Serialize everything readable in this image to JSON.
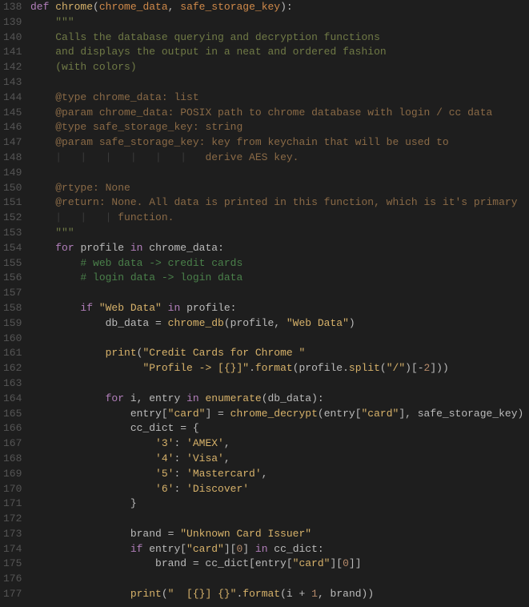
{
  "lines": [
    {
      "n": 138,
      "t": [
        [
          "kw",
          "def "
        ],
        [
          "fn",
          "chrome"
        ],
        [
          "plain",
          "("
        ],
        [
          "param",
          "chrome_data"
        ],
        [
          "plain",
          ", "
        ],
        [
          "param",
          "safe_storage_key"
        ],
        [
          "plain",
          "):"
        ]
      ]
    },
    {
      "n": 139,
      "t": [
        [
          "plain",
          "    "
        ],
        [
          "doc",
          "\"\"\""
        ]
      ]
    },
    {
      "n": 140,
      "t": [
        [
          "plain",
          "    "
        ],
        [
          "doc",
          "Calls the database querying and decryption functions"
        ]
      ]
    },
    {
      "n": 141,
      "t": [
        [
          "plain",
          "    "
        ],
        [
          "doc",
          "and displays the output in a neat and ordered fashion"
        ]
      ]
    },
    {
      "n": 142,
      "t": [
        [
          "plain",
          "    "
        ],
        [
          "doc",
          "(with colors)"
        ]
      ]
    },
    {
      "n": 143,
      "t": [
        [
          "plain",
          ""
        ]
      ]
    },
    {
      "n": 144,
      "t": [
        [
          "plain",
          "    "
        ],
        [
          "doctag",
          "@type chrome_data: list"
        ]
      ]
    },
    {
      "n": 145,
      "t": [
        [
          "plain",
          "    "
        ],
        [
          "doctag",
          "@param chrome_data: POSIX path to chrome database with login / cc data"
        ]
      ]
    },
    {
      "n": 146,
      "t": [
        [
          "plain",
          "    "
        ],
        [
          "doctag",
          "@type safe_storage_key: string"
        ]
      ]
    },
    {
      "n": 147,
      "t": [
        [
          "plain",
          "    "
        ],
        [
          "doctag",
          "@param safe_storage_key: key from keychain that will be used to"
        ]
      ]
    },
    {
      "n": 148,
      "t": [
        [
          "plain",
          "    "
        ],
        [
          "indentmk",
          "|   |   |   |   |   |   "
        ],
        [
          "doctag",
          "derive AES key."
        ]
      ]
    },
    {
      "n": 149,
      "t": [
        [
          "plain",
          ""
        ]
      ]
    },
    {
      "n": 150,
      "t": [
        [
          "plain",
          "    "
        ],
        [
          "doctag",
          "@rtype: None"
        ]
      ]
    },
    {
      "n": 151,
      "t": [
        [
          "plain",
          "    "
        ],
        [
          "doctag",
          "@return: None. All data is printed in this function, which is it's primary"
        ]
      ]
    },
    {
      "n": 152,
      "t": [
        [
          "plain",
          "    "
        ],
        [
          "indentmk",
          "|   |   | "
        ],
        [
          "doctag",
          "function."
        ]
      ]
    },
    {
      "n": 153,
      "t": [
        [
          "plain",
          "    "
        ],
        [
          "doc",
          "\"\"\""
        ]
      ]
    },
    {
      "n": 154,
      "t": [
        [
          "plain",
          "    "
        ],
        [
          "kw",
          "for "
        ],
        [
          "plain",
          "profile "
        ],
        [
          "kw",
          "in "
        ],
        [
          "plain",
          "chrome_data:"
        ]
      ]
    },
    {
      "n": 155,
      "t": [
        [
          "plain",
          "        "
        ],
        [
          "comment",
          "# web data -> credit cards"
        ]
      ]
    },
    {
      "n": 156,
      "t": [
        [
          "plain",
          "        "
        ],
        [
          "comment",
          "# login data -> login data"
        ]
      ]
    },
    {
      "n": 157,
      "t": [
        [
          "plain",
          ""
        ]
      ]
    },
    {
      "n": 158,
      "t": [
        [
          "plain",
          "        "
        ],
        [
          "kw",
          "if "
        ],
        [
          "str",
          "\"Web Data\""
        ],
        [
          "plain",
          " "
        ],
        [
          "kw",
          "in "
        ],
        [
          "plain",
          "profile:"
        ]
      ]
    },
    {
      "n": 159,
      "t": [
        [
          "plain",
          "            db_data = "
        ],
        [
          "fn",
          "chrome_db"
        ],
        [
          "plain",
          "(profile, "
        ],
        [
          "str",
          "\"Web Data\""
        ],
        [
          "plain",
          ")"
        ]
      ]
    },
    {
      "n": 160,
      "t": [
        [
          "plain",
          ""
        ]
      ]
    },
    {
      "n": 161,
      "t": [
        [
          "plain",
          "            "
        ],
        [
          "fn",
          "print"
        ],
        [
          "plain",
          "("
        ],
        [
          "str",
          "\"Credit Cards for Chrome \""
        ]
      ]
    },
    {
      "n": 162,
      "t": [
        [
          "plain",
          "                  "
        ],
        [
          "str",
          "\"Profile -> [{}]\""
        ],
        [
          "plain",
          "."
        ],
        [
          "fn",
          "format"
        ],
        [
          "plain",
          "(profile."
        ],
        [
          "fn",
          "split"
        ],
        [
          "plain",
          "("
        ],
        [
          "str",
          "\"/\""
        ],
        [
          "plain",
          ")[-"
        ],
        [
          "num",
          "2"
        ],
        [
          "plain",
          "]))"
        ]
      ]
    },
    {
      "n": 163,
      "t": [
        [
          "plain",
          ""
        ]
      ]
    },
    {
      "n": 164,
      "t": [
        [
          "plain",
          "            "
        ],
        [
          "kw",
          "for "
        ],
        [
          "plain",
          "i, entry "
        ],
        [
          "kw",
          "in "
        ],
        [
          "fn",
          "enumerate"
        ],
        [
          "plain",
          "(db_data):"
        ]
      ]
    },
    {
      "n": 165,
      "t": [
        [
          "plain",
          "                entry["
        ],
        [
          "str",
          "\"card\""
        ],
        [
          "plain",
          "] = "
        ],
        [
          "fn",
          "chrome_decrypt"
        ],
        [
          "plain",
          "(entry["
        ],
        [
          "str",
          "\"card\""
        ],
        [
          "plain",
          "], safe_storage_key)"
        ]
      ]
    },
    {
      "n": 166,
      "t": [
        [
          "plain",
          "                cc_dict = {"
        ]
      ]
    },
    {
      "n": 167,
      "t": [
        [
          "plain",
          "                    "
        ],
        [
          "str",
          "'3'"
        ],
        [
          "plain",
          ": "
        ],
        [
          "str",
          "'AMEX'"
        ],
        [
          "plain",
          ","
        ]
      ]
    },
    {
      "n": 168,
      "t": [
        [
          "plain",
          "                    "
        ],
        [
          "str",
          "'4'"
        ],
        [
          "plain",
          ": "
        ],
        [
          "str",
          "'Visa'"
        ],
        [
          "plain",
          ","
        ]
      ]
    },
    {
      "n": 169,
      "t": [
        [
          "plain",
          "                    "
        ],
        [
          "str",
          "'5'"
        ],
        [
          "plain",
          ": "
        ],
        [
          "str",
          "'Mastercard'"
        ],
        [
          "plain",
          ","
        ]
      ]
    },
    {
      "n": 170,
      "t": [
        [
          "plain",
          "                    "
        ],
        [
          "str",
          "'6'"
        ],
        [
          "plain",
          ": "
        ],
        [
          "str",
          "'Discover'"
        ]
      ]
    },
    {
      "n": 171,
      "t": [
        [
          "plain",
          "                }"
        ]
      ]
    },
    {
      "n": 172,
      "t": [
        [
          "plain",
          ""
        ]
      ]
    },
    {
      "n": 173,
      "t": [
        [
          "plain",
          "                brand = "
        ],
        [
          "str",
          "\"Unknown Card Issuer\""
        ]
      ]
    },
    {
      "n": 174,
      "t": [
        [
          "plain",
          "                "
        ],
        [
          "kw",
          "if "
        ],
        [
          "plain",
          "entry["
        ],
        [
          "str",
          "\"card\""
        ],
        [
          "plain",
          "]["
        ],
        [
          "num",
          "0"
        ],
        [
          "plain",
          "] "
        ],
        [
          "kw",
          "in "
        ],
        [
          "plain",
          "cc_dict:"
        ]
      ]
    },
    {
      "n": 175,
      "t": [
        [
          "plain",
          "                    brand = cc_dict[entry["
        ],
        [
          "str",
          "\"card\""
        ],
        [
          "plain",
          "]["
        ],
        [
          "num",
          "0"
        ],
        [
          "plain",
          "]]"
        ]
      ]
    },
    {
      "n": 176,
      "t": [
        [
          "plain",
          ""
        ]
      ]
    },
    {
      "n": 177,
      "t": [
        [
          "plain",
          "                "
        ],
        [
          "fn",
          "print"
        ],
        [
          "plain",
          "("
        ],
        [
          "str",
          "\"  [{}] {}\""
        ],
        [
          "plain",
          "."
        ],
        [
          "fn",
          "format"
        ],
        [
          "plain",
          "(i + "
        ],
        [
          "num",
          "1"
        ],
        [
          "plain",
          ", brand))"
        ]
      ]
    }
  ]
}
